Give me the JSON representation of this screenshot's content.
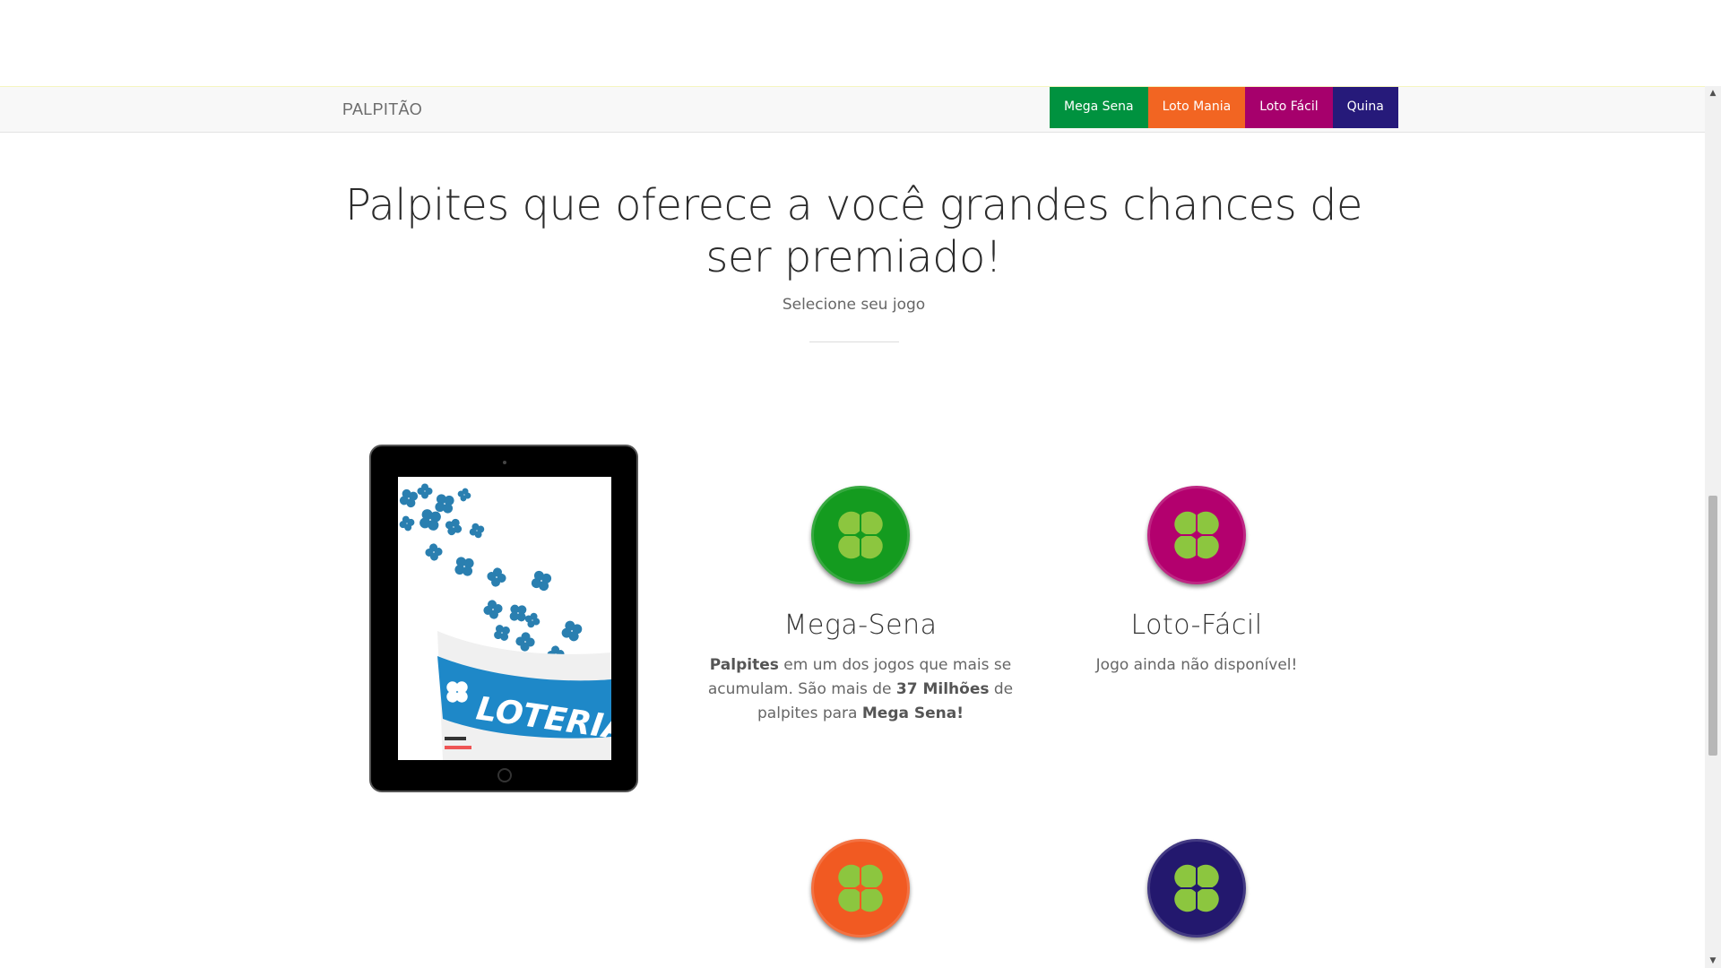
{
  "navbar": {
    "brand": "PALPITÃO",
    "buttons": [
      {
        "label": "Mega Sena",
        "color": "#00923f"
      },
      {
        "label": "Loto Mania",
        "color": "#f26522"
      },
      {
        "label": "Loto Fácil",
        "color": "#a6006c"
      },
      {
        "label": "Quina",
        "color": "#261a7a"
      }
    ]
  },
  "hero": {
    "title": "Palpites que oferece a você grandes chances de ser premiado!",
    "subtitle": "Selecione seu jogo"
  },
  "tablet": {
    "screen_text": "LOTERIAS"
  },
  "games": [
    {
      "title": "Mega-Sena",
      "color": "#149b1f",
      "icon": "clover-icon",
      "desc_parts": {
        "b1": "Palpites",
        "t1": " em um dos jogos que mais se acumulam. São mais de ",
        "b2": "37 Milhões",
        "t2": " de palpites para ",
        "b3": "Mega Sena!"
      }
    },
    {
      "title": "Loto-Fácil",
      "color": "#b3006e",
      "icon": "clover-icon",
      "desc": "Jogo ainda não disponível!"
    },
    {
      "color": "#f15a22",
      "icon": "clover-icon"
    },
    {
      "color": "#23186e",
      "icon": "clover-icon"
    }
  ],
  "clover_color": "#8cc63f"
}
